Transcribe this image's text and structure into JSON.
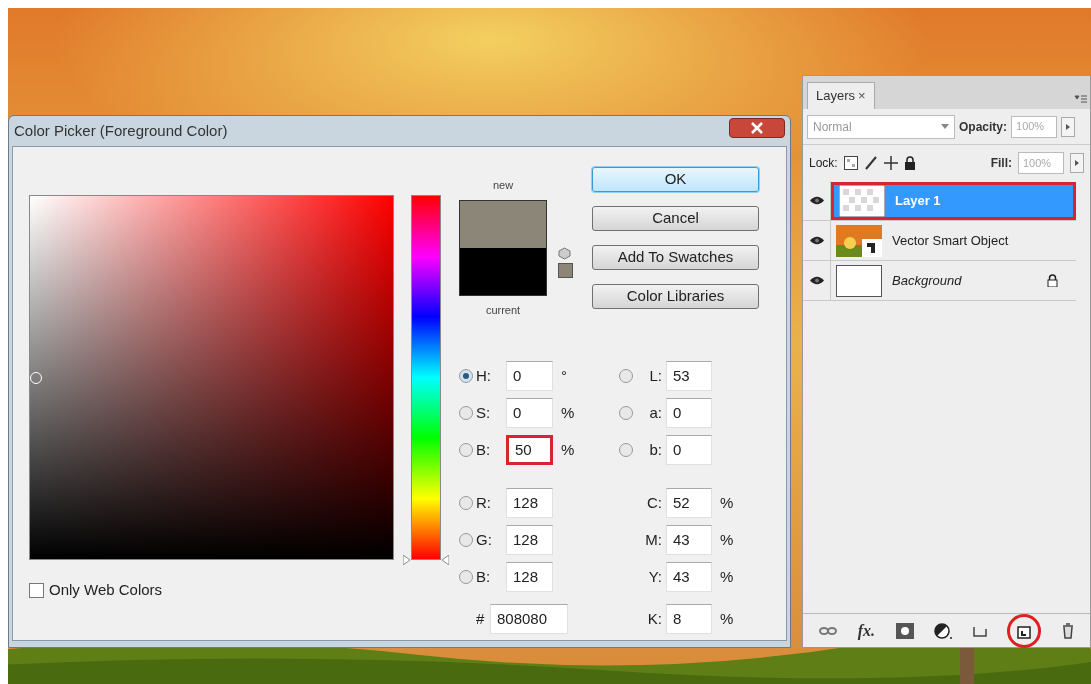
{
  "dialog": {
    "title": "Color Picker (Foreground Color)",
    "swatches": [
      {
        "label": "new",
        "color": "#8b8677"
      },
      {
        "label": "current",
        "color": "#000000"
      }
    ],
    "buttons": [
      {
        "label": "OK",
        "default": true
      },
      {
        "label": "Cancel",
        "default": false
      },
      {
        "label": "Add To Swatches",
        "default": false
      },
      {
        "label": "Color Libraries",
        "default": false
      }
    ],
    "hue_slider": {
      "level": 0
    },
    "only_web_colors": {
      "label": "Only Web Colors",
      "checked": false
    },
    "left_fields": [
      {
        "kind": "radio",
        "label": "H:",
        "value": "0",
        "unit": "°",
        "selected": true,
        "marked": false
      },
      {
        "kind": "radio",
        "label": "S:",
        "value": "0",
        "unit": "%",
        "selected": false,
        "marked": false
      },
      {
        "kind": "radio",
        "label": "B:",
        "value": "50",
        "unit": "%",
        "selected": false,
        "marked": true
      },
      {
        "kind": "radio",
        "label": "R:",
        "value": "128",
        "selected": false,
        "marked": false
      },
      {
        "kind": "radio",
        "label": "G:",
        "value": "128",
        "selected": false,
        "marked": false
      },
      {
        "kind": "radio",
        "label": "B:",
        "value": "128",
        "selected": false,
        "marked": false
      },
      {
        "kind": "plain",
        "label": "#",
        "value": "808080",
        "marked": false
      }
    ],
    "right_fields": [
      {
        "kind": "radio",
        "label": "L:",
        "value": "53",
        "selected": false,
        "marked": false
      },
      {
        "kind": "radio",
        "label": "a:",
        "value": "0",
        "selected": false,
        "marked": false
      },
      {
        "kind": "radio",
        "label": "b:",
        "value": "0",
        "selected": false,
        "marked": false
      },
      {
        "kind": "plain",
        "label": "C:",
        "value": "52",
        "unit": "%",
        "marked": false
      },
      {
        "kind": "plain",
        "label": "M:",
        "value": "43",
        "unit": "%",
        "marked": false
      },
      {
        "kind": "plain",
        "label": "Y:",
        "value": "43",
        "unit": "%",
        "marked": false
      },
      {
        "kind": "plain",
        "label": "K:",
        "value": "8",
        "unit": "%",
        "marked": false
      }
    ]
  },
  "layers_panel": {
    "tab": {
      "label": "Layers",
      "close": "×"
    },
    "blend_mode": "Normal",
    "opacity_label": "Opacity:",
    "opacity": "100%",
    "lock_label": "Lock:",
    "fill_label": "Fill:",
    "fill": "100%",
    "layers": [
      {
        "kind": "pixel",
        "name": "Layer 1",
        "visible": true,
        "selected": true,
        "marked": true,
        "locked": false
      },
      {
        "kind": "smart",
        "name": "Vector Smart Object",
        "visible": true,
        "selected": false,
        "marked": false,
        "locked": false
      },
      {
        "kind": "background",
        "name": "Background",
        "visible": true,
        "selected": false,
        "marked": false,
        "locked": true
      }
    ],
    "footer_tools": [
      {
        "kind": "link",
        "circled": false
      },
      {
        "kind": "fx",
        "label": "fx.",
        "circled": false
      },
      {
        "kind": "mask",
        "circled": false
      },
      {
        "kind": "adjust",
        "circled": false
      },
      {
        "kind": "group",
        "circled": false
      },
      {
        "kind": "new",
        "circled": true
      },
      {
        "kind": "trash",
        "circled": false
      }
    ]
  }
}
